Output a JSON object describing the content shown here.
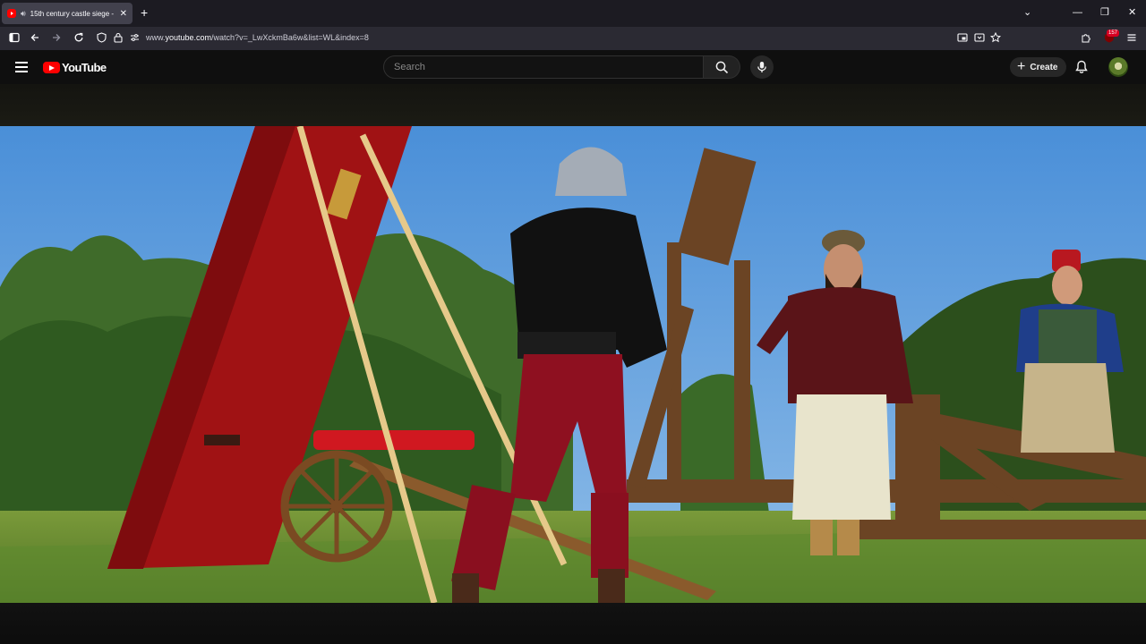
{
  "browser": {
    "tab": {
      "title": "15th century castle siege -",
      "favicon": "youtube-favicon",
      "audio_icon": "speaker-icon"
    },
    "new_tab_label": "+",
    "url_prefix": "www.",
    "url_domain": "youtube.com",
    "url_path": "/watch?v=_LwXckmBa6w&list=WL&index=8",
    "extensions_badge": "157"
  },
  "youtube": {
    "logo_text": "YouTube",
    "search": {
      "placeholder": "Search",
      "value": ""
    },
    "create_label": "Create",
    "icons": [
      "menu-icon",
      "search-icon",
      "microphone-icon",
      "plus-icon",
      "bell-icon"
    ]
  },
  "colors": {
    "yt_red": "#ff0000",
    "bg": "#0f0f0f",
    "tab_active": "#42414d",
    "toolbar": "#2b2a33"
  }
}
